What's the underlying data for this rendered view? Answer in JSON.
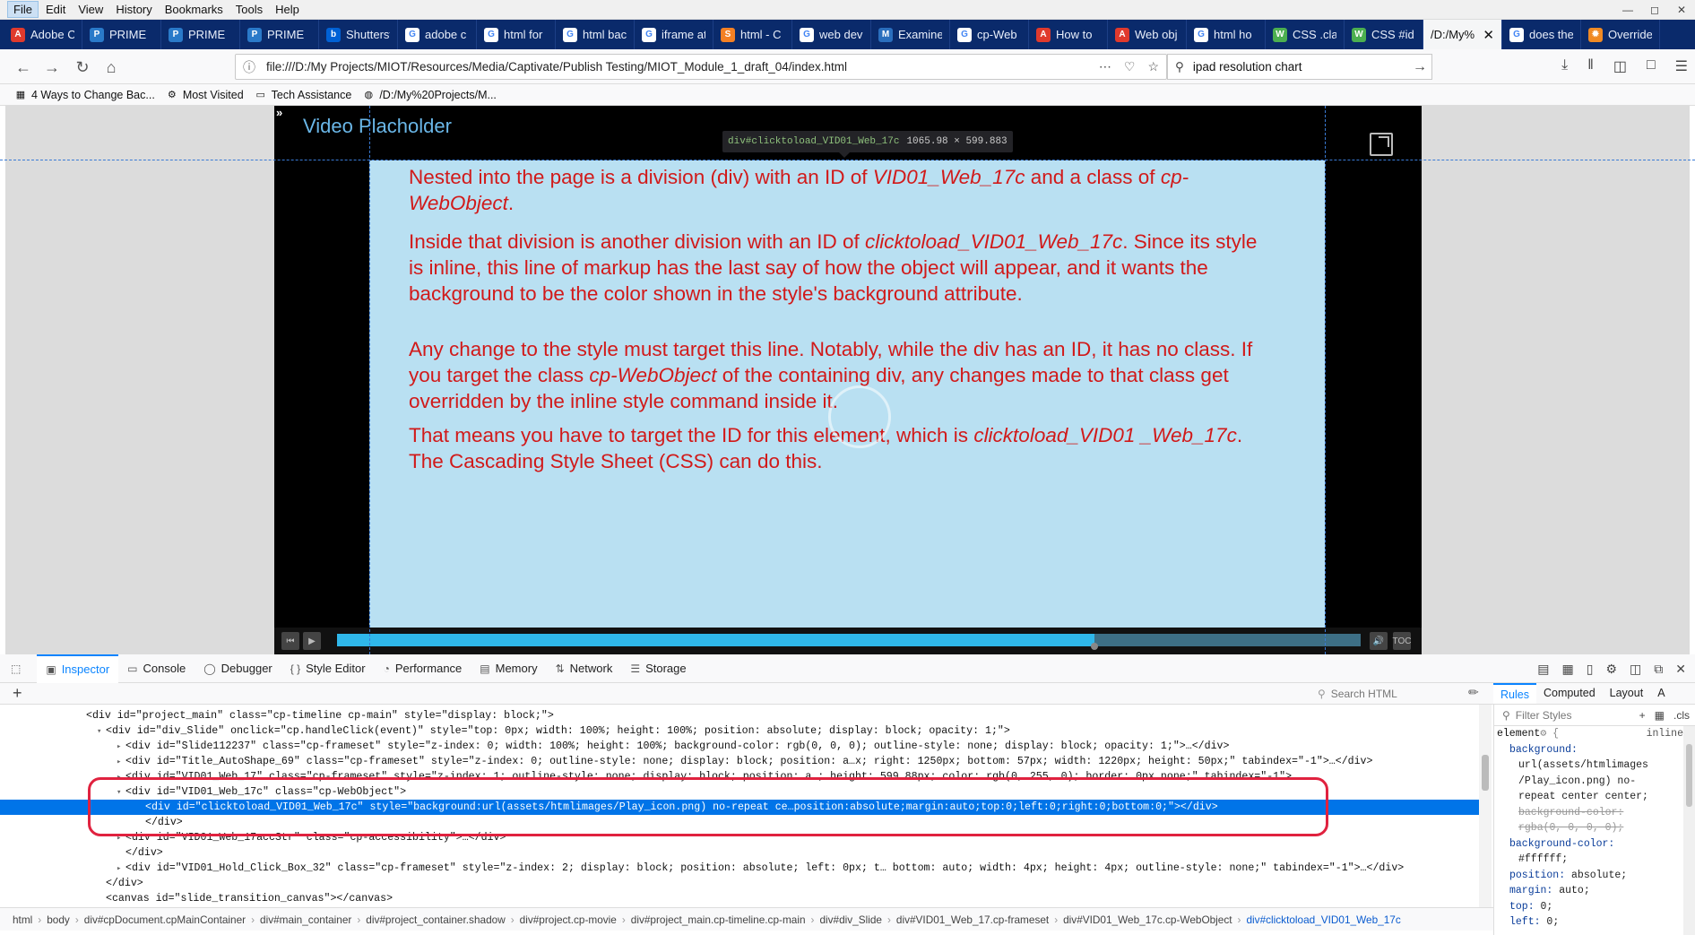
{
  "menubar": {
    "items": [
      "File",
      "Edit",
      "View",
      "History",
      "Bookmarks",
      "Tools",
      "Help"
    ]
  },
  "tabs": [
    {
      "label": "Adobe C",
      "icon": "adobe-icon",
      "color": "#e03a2d"
    },
    {
      "label": "PRIME",
      "icon": "prime-icon",
      "color": "#2a7ac9"
    },
    {
      "label": "PRIME",
      "icon": "prime-icon",
      "color": "#2a7ac9"
    },
    {
      "label": "PRIME",
      "icon": "prime-icon",
      "color": "#2a7ac9"
    },
    {
      "label": "Shutterst",
      "icon": "box-icon",
      "color": "#0061d5"
    },
    {
      "label": "adobe c",
      "icon": "google-icon",
      "color": "#ffffff"
    },
    {
      "label": "html for",
      "icon": "google-icon",
      "color": "#ffffff"
    },
    {
      "label": "html bac",
      "icon": "google-icon",
      "color": "#ffffff"
    },
    {
      "label": "iframe at",
      "icon": "google-icon",
      "color": "#ffffff"
    },
    {
      "label": "html - C",
      "icon": "stackoverflow-icon",
      "color": "#f48024"
    },
    {
      "label": "web dev",
      "icon": "google-icon",
      "color": "#ffffff"
    },
    {
      "label": "Examine",
      "icon": "mdn-icon",
      "color": "#2a6ebd"
    },
    {
      "label": "cp-Web",
      "icon": "google-icon",
      "color": "#ffffff"
    },
    {
      "label": "How to",
      "icon": "adobe-icon",
      "color": "#e03a2d"
    },
    {
      "label": "Web obj",
      "icon": "adobe-icon",
      "color": "#e03a2d"
    },
    {
      "label": "html ho",
      "icon": "google-icon",
      "color": "#ffffff"
    },
    {
      "label": "CSS .clas",
      "icon": "w3-icon",
      "color": "#4caf50"
    },
    {
      "label": "CSS #id",
      "icon": "w3-icon",
      "color": "#4caf50"
    },
    {
      "label": "/D:/My%",
      "icon": "",
      "color": "#f5f6f7",
      "active": true
    },
    {
      "label": "does the",
      "icon": "google-icon",
      "color": "#ffffff"
    },
    {
      "label": "Override",
      "icon": "sun-icon",
      "color": "#f08a24"
    }
  ],
  "nav": {
    "url": "file:///D:/My Projects/MIOT/Resources/Media/Captivate/Publish Testing/MIOT_Module_1_draft_04/index.html",
    "search": "ipad resolution chart"
  },
  "bookmarks": [
    {
      "label": "4 Ways to Change Bac...",
      "icon": "bookmark-favicon-icon"
    },
    {
      "label": "Most Visited",
      "icon": "gear-icon"
    },
    {
      "label": "Tech Assistance",
      "icon": "folder-icon"
    },
    {
      "label": "/D:/My%20Projects/M...",
      "icon": "globe-icon"
    }
  ],
  "stage": {
    "title": "Video Placholder",
    "tooltip_selector": "div#clicktoload_VID01_Web_17c",
    "tooltip_size": "1065.98 × 599.883",
    "progress": 0.74
  },
  "webobject": {
    "paragraphs": [
      [
        {
          "t": "Nested into the page is a division (div) with an ID of "
        },
        {
          "t": "VID01_Web_17c",
          "i": true
        },
        {
          "t": " and a class of "
        },
        {
          "t": "cp-WebObject",
          "i": true
        },
        {
          "t": "."
        }
      ],
      [
        {
          "t": "Inside that division is another division with an ID of "
        },
        {
          "t": "clicktoload_VID01_Web_17c",
          "i": true
        },
        {
          "t": ". Since its style is inline, this line of markup has the last say of how the object will appear, and it wants the background to be the color shown in the style's background attribute."
        }
      ],
      [
        {
          "t": "Any change to the style must target this line. Notably, while the div has an ID, it has no class. If you target the class "
        },
        {
          "t": "cp-WebObject",
          "i": true
        },
        {
          "t": " of the containing div, any changes made to that class get overridden by the inline style command inside it."
        }
      ],
      [
        {
          "t": "That means you have to target the ID for this element, which is "
        },
        {
          "t": "clicktoload_VID01 _Web_17c",
          "i": true
        },
        {
          "t": ". The Cascading Style Sheet (CSS) can do this."
        }
      ]
    ]
  },
  "devtools": {
    "tabs": [
      {
        "label": "Inspector",
        "icon": "inspector-icon",
        "active": true
      },
      {
        "label": "Console",
        "icon": "console-icon"
      },
      {
        "label": "Debugger",
        "icon": "debugger-icon"
      },
      {
        "label": "Style Editor",
        "icon": "style-editor-icon"
      },
      {
        "label": "Performance",
        "icon": "performance-icon"
      },
      {
        "label": "Memory",
        "icon": "memory-icon"
      },
      {
        "label": "Network",
        "icon": "network-icon"
      },
      {
        "label": "Storage",
        "icon": "storage-icon"
      }
    ],
    "search_placeholder": "Search HTML",
    "markup": [
      {
        "indent": 6,
        "tw": "",
        "html": "<div id=\"project_main\" class=\"cp-timeline cp-main\" style=\"display: block;\">"
      },
      {
        "indent": 8,
        "tw": "▾",
        "html": "<div id=\"div_Slide\" onclick=\"cp.handleClick(event)\" style=\"top: 0px; width: 100%; height: 100%; position: absolute; display: block; opacity: 1;\">"
      },
      {
        "indent": 10,
        "tw": "▸",
        "html": "<div id=\"Slide112237\" class=\"cp-frameset\" style=\"z-index: 0; width: 100%; height: 100%; background-color: rgb(0, 0, 0); outline-style: none; display: block; opacity: 1;\">…</div>"
      },
      {
        "indent": 10,
        "tw": "▸",
        "html": "<div id=\"Title_AutoShape_69\" class=\"cp-frameset\" style=\"z-index: 0; outline-style: none; display: block; position: a…x; right: 1250px; bottom: 57px; width: 1220px; height: 50px;\" tabindex=\"-1\">…</div>"
      },
      {
        "indent": 10,
        "tw": "▸",
        "html": "<div id=\"VID01_Web_17\" class=\"cp-frameset\" style=\"z-index: 1; outline-style: none; display: block; position: a…; height: 599.88px; color: rgb(0, 255, 0); border: 0px none;\" tabindex=\"-1\">"
      },
      {
        "indent": 10,
        "tw": "▾",
        "html": "<div id=\"VID01_Web_17c\" class=\"cp-WebObject\">"
      },
      {
        "indent": 12,
        "tw": "",
        "sel": true,
        "html": "<div id=\"clicktoload_VID01_Web_17c\" style=\"background:url(assets/htmlimages/Play_icon.png) no-repeat ce…position:absolute;margin:auto;top:0;left:0;right:0;bottom:0;\"></div>"
      },
      {
        "indent": 12,
        "tw": "",
        "html": "</div>"
      },
      {
        "indent": 10,
        "tw": "▸",
        "html": "<div id=\"VID01_Web_17accStr\" class=\"cp-accessibility\">…</div>"
      },
      {
        "indent": 10,
        "tw": "",
        "html": "</div>"
      },
      {
        "indent": 10,
        "tw": "▸",
        "html": "<div id=\"VID01_Hold_Click_Box_32\" class=\"cp-frameset\" style=\"z-index: 2; display: block; position: absolute; left: 0px; t… bottom: auto; width: 4px; height: 4px; outline-style: none;\" tabindex=\"-1\">…</div>"
      },
      {
        "indent": 8,
        "tw": "",
        "html": "</div>"
      },
      {
        "indent": 8,
        "tw": "",
        "html": "<canvas id=\"slide_transition_canvas\"></canvas>"
      }
    ],
    "breadcrumbs": [
      "html",
      "body",
      "div#cpDocument.cpMainContainer",
      "div#main_container",
      "div#project_container.shadow",
      "div#project.cp-movie",
      "div#project_main.cp-timeline.cp-main",
      "div#div_Slide",
      "div#VID01_Web_17.cp-frameset",
      "div#VID01_Web_17c.cp-WebObject",
      "div#clicktoload_VID01_Web_17c"
    ],
    "rules_tabs": [
      {
        "label": "Rules",
        "active": true
      },
      {
        "label": "Computed"
      },
      {
        "label": "Layout"
      },
      {
        "label": "A"
      }
    ],
    "filter_placeholder": "Filter Styles",
    "filter_cls": ".cls",
    "rules": {
      "selector": "element",
      "source": "inline",
      "lines": [
        {
          "p": "background:",
          "v": ""
        },
        {
          "p": "",
          "v": "url(assets/htmlimages"
        },
        {
          "p": "",
          "v": "/Play_icon.png) no-"
        },
        {
          "p": "",
          "v": "repeat center center;"
        },
        {
          "p": "",
          "v": "background-color:",
          "strike": true
        },
        {
          "p": "",
          "v": "rgba(0, 0, 0, 0);",
          "strike": true
        },
        {
          "p": "background-color:",
          "v": ""
        },
        {
          "p": "",
          "v": "#ffffff;"
        },
        {
          "p": "position:",
          "v": "absolute;"
        },
        {
          "p": "margin:",
          "v": "auto;"
        },
        {
          "p": "top:",
          "v": "0;"
        },
        {
          "p": "left:",
          "v": "0;"
        }
      ]
    }
  }
}
